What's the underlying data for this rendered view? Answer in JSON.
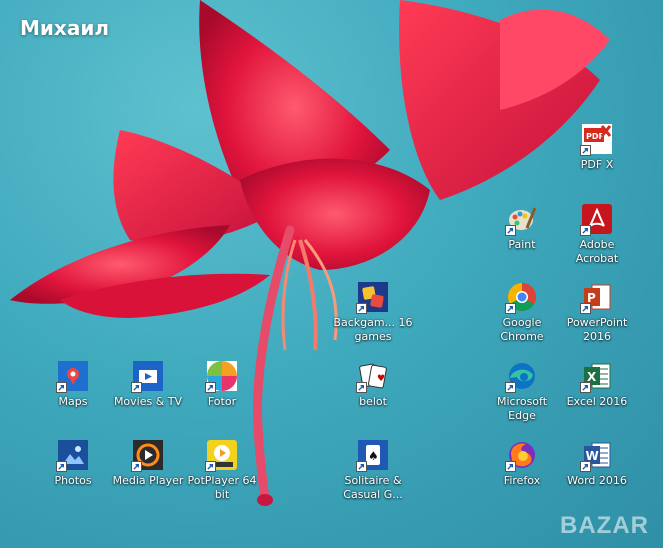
{
  "user": {
    "name": "Михаил"
  },
  "icons": [
    {
      "label": "Maps",
      "icon": "maps-icon",
      "color": "#1f6fd0"
    },
    {
      "label": "Movies & TV",
      "icon": "movies-tv-icon",
      "color": "#1c64c8"
    },
    {
      "label": "Fotor",
      "icon": "fotor-icon",
      "color": "#f4a020"
    },
    {
      "label": "Photos",
      "icon": "photos-icon",
      "color": "#1a4f9c"
    },
    {
      "label": "Media Player",
      "icon": "media-player-icon",
      "color": "#2b2b2b"
    },
    {
      "label": "PotPlayer 64 bit",
      "icon": "potplayer-icon",
      "color": "#f2d21c"
    },
    {
      "label": "Backgam... 16 games",
      "icon": "backgammon-icon",
      "color": "#1d3a8a"
    },
    {
      "label": "belot",
      "icon": "cards-icon",
      "color": "#ffffff"
    },
    {
      "label": "Solitaire & Casual G...",
      "icon": "solitaire-icon",
      "color": "#1e5ab3"
    },
    {
      "label": "Paint",
      "icon": "paint-icon",
      "color": "#e9e0c9"
    },
    {
      "label": "Google Chrome",
      "icon": "chrome-icon",
      "color": "#34a853"
    },
    {
      "label": "Microsoft Edge",
      "icon": "edge-icon",
      "color": "#1aa0a0"
    },
    {
      "label": "Firefox",
      "icon": "firefox-icon",
      "color": "#ff7a1a"
    },
    {
      "label": "PDF X",
      "icon": "pdf-x-icon",
      "color": "#d52b1e"
    },
    {
      "label": "Adobe Acrobat",
      "icon": "acrobat-icon",
      "color": "#c4161c"
    },
    {
      "label": "PowerPoint 2016",
      "icon": "powerpoint-icon",
      "color": "#c43e1c"
    },
    {
      "label": "Excel 2016",
      "icon": "excel-icon",
      "color": "#1d7044"
    },
    {
      "label": "Word 2016",
      "icon": "word-icon",
      "color": "#2b579a"
    }
  ],
  "watermark": {
    "text": "BAZAR"
  }
}
